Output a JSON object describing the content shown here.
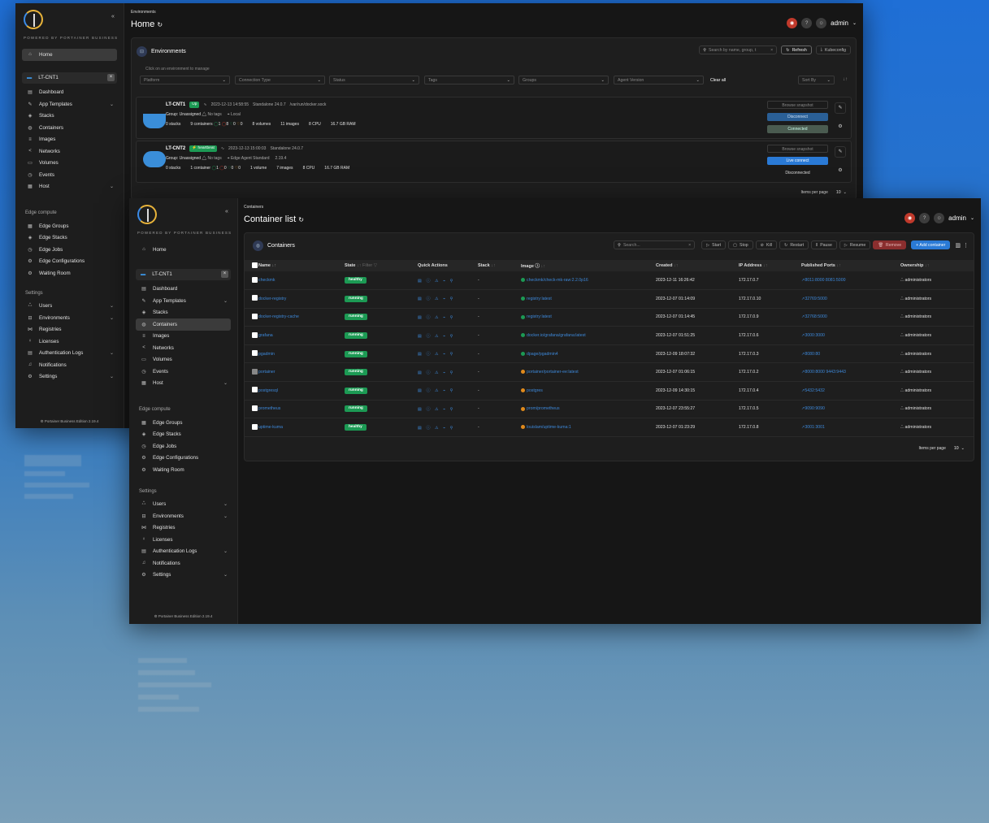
{
  "back": {
    "crumb": "Environments",
    "title": "Home",
    "user": "admin",
    "sidebar": {
      "home": "Home",
      "env": "LT-CNT1",
      "items": [
        "Dashboard",
        "App Templates",
        "Stacks",
        "Containers",
        "Images",
        "Networks",
        "Volumes",
        "Events",
        "Host"
      ],
      "edge_title": "Edge compute",
      "edge": [
        "Edge Groups",
        "Edge Stacks",
        "Edge Jobs",
        "Edge Configurations",
        "Waiting Room"
      ],
      "settings_title": "Settings",
      "settings": [
        "Users",
        "Environments",
        "Registries",
        "Licenses",
        "Authentication Logs",
        "Notifications",
        "Settings"
      ],
      "footer": "⚙ Portainer Business Edition 2.19.4"
    },
    "panel": {
      "title": "Environments",
      "hint": "Click on an environment to manage",
      "search_placeholder": "Search by name, group, t",
      "refresh": "Refresh",
      "kubeconfig": "Kubeconfig",
      "filters": [
        "Platform",
        "Connection Type",
        "Status",
        "Tags",
        "Groups",
        "Agent Version"
      ],
      "clear": "Clear all",
      "sort": "Sort By",
      "items_per_page": "Items per page",
      "per_page": "10",
      "envs": [
        {
          "name": "LT-CNT1",
          "status": "Up",
          "time": "2023-12-13 14:58:55",
          "type": "Standalone 24.0.7",
          "socket": "/var/run/docker.sock",
          "group": "Group: Unassigned",
          "tags": "No tags",
          "loc": "Local",
          "stacks": "0 stacks",
          "containers": "9 containers",
          "c1": "1",
          "c2": "8",
          "c3": "0",
          "c4": "0",
          "volumes": "8 volumes",
          "images": "11 images",
          "cpu": "8 CPU",
          "ram": "16.7 GB RAM",
          "btn1": "Browse snapshot",
          "btn2": "Disconnect",
          "btn3": "Connected"
        },
        {
          "name": "LT-CNT2",
          "status": "heartbeat",
          "time": "2023-12-13 15:00:03",
          "type": "Standalone 24.0.7",
          "socket": "",
          "group": "Group: Unassigned",
          "tags": "No tags",
          "loc": "Edge Agent Standard",
          "ver": "2.19.4",
          "stacks": "0 stacks",
          "containers": "1 container",
          "c1": "1",
          "c2": "0",
          "c3": "0",
          "c4": "0",
          "volumes": "1 volume",
          "images": "7 images",
          "cpu": "8 CPU",
          "ram": "16.7 GB RAM",
          "btn1": "Browse snapshot",
          "btn2": "Live connect",
          "btn3": "Disconnected"
        }
      ]
    }
  },
  "front": {
    "crumb": "Containers",
    "title": "Container list",
    "user": "admin",
    "panel": {
      "title": "Containers",
      "search_placeholder": "Search...",
      "actions": [
        "Start",
        "Stop",
        "Kill",
        "Restart",
        "Pause",
        "Resume",
        "Remove"
      ],
      "add": "+ Add container",
      "columns": [
        "Name",
        "State",
        "Filter",
        "Quick Actions",
        "Stack",
        "Image",
        "Created",
        "IP Address",
        "Published Ports",
        "Ownership"
      ],
      "rows": [
        {
          "name": "checkmk",
          "state": "healthy",
          "stack": "-",
          "image": "checkmk/check-mk-raw:2.2.0p16",
          "img_color": "#1c9a54",
          "created": "2023-12-11 16:26:42",
          "ip": "172.17.0.7",
          "ports": "8011:8000  8081:5000",
          "own": "administrators"
        },
        {
          "name": "docker-registry",
          "state": "running",
          "stack": "-",
          "image": "registry:latest",
          "img_color": "#1c9a54",
          "created": "2023-12-07 01:14:09",
          "ip": "172.17.0.10",
          "ports": "32769:5000",
          "own": "administrators"
        },
        {
          "name": "docker-registry-cache",
          "state": "running",
          "stack": "-",
          "image": "registry:latest",
          "img_color": "#1c9a54",
          "created": "2023-12-07 01:14:45",
          "ip": "172.17.0.9",
          "ports": "32768:5000",
          "own": "administrators"
        },
        {
          "name": "grafana",
          "state": "running",
          "stack": "-",
          "image": "docker.io/grafana/grafana:latest",
          "img_color": "#1c9a54",
          "created": "2023-12-07 01:51:25",
          "ip": "172.17.0.6",
          "ports": "3000:3000",
          "own": "administrators"
        },
        {
          "name": "pgadmin",
          "state": "running",
          "stack": "-",
          "image": "dpage/pgadmin4",
          "img_color": "#1c9a54",
          "created": "2023-12-09 18:07:32",
          "ip": "172.17.0.3",
          "ports": "8080:80",
          "own": "administrators"
        },
        {
          "name": "portainer",
          "state": "running",
          "stack": "-",
          "image": "portainer/portainer-ee:latest",
          "img_color": "#e08a1c",
          "created": "2023-12-07 01:06:15",
          "ip": "172.17.0.2",
          "ports": "8000:8000  9443:9443",
          "own": "administrators"
        },
        {
          "name": "postgresql",
          "state": "running",
          "stack": "-",
          "image": "postgres",
          "img_color": "#e08a1c",
          "created": "2023-12-09 14:30:15",
          "ip": "172.17.0.4",
          "ports": "5432:5432",
          "own": "administrators"
        },
        {
          "name": "prometheus",
          "state": "running",
          "stack": "-",
          "image": "prom/prometheus",
          "img_color": "#e08a1c",
          "created": "2023-12-07 23:55:27",
          "ip": "172.17.0.5",
          "ports": "9090:9090",
          "own": "administrators"
        },
        {
          "name": "uptime-kuma",
          "state": "healthy",
          "stack": "-",
          "image": "louislam/uptime-kuma:1",
          "img_color": "#e08a1c",
          "created": "2023-12-07 01:23:29",
          "ip": "172.17.0.8",
          "ports": "3001:3001",
          "own": "administrators"
        }
      ],
      "items_per_page": "Items per page",
      "per_page": "10"
    }
  }
}
